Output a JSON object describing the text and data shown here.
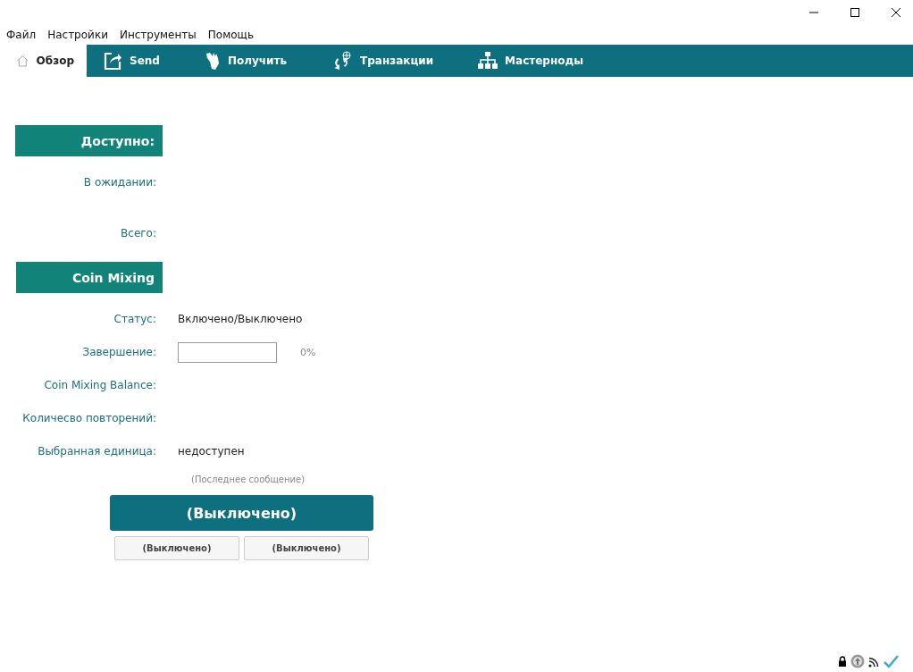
{
  "menu": [
    "Файл",
    "Настройки",
    "Инструменты",
    "Помощь"
  ],
  "tabs": [
    {
      "label": "Обзор",
      "kind": "home",
      "selected": true
    },
    {
      "label": "Send",
      "kind": "send",
      "selected": false
    },
    {
      "label": "Получить",
      "kind": "receive",
      "selected": false
    },
    {
      "label": "Транзакции",
      "kind": "transactions",
      "selected": false
    },
    {
      "label": "Мастерноды",
      "kind": "masternodes",
      "selected": false
    }
  ],
  "balances": {
    "header": "Доступно:",
    "pending": {
      "label": "В ожидании:"
    },
    "total": {
      "label": "Всего:"
    }
  },
  "mixing": {
    "header": "Coin Mixing",
    "status": {
      "label": "Статус:",
      "value": "Включено/Выключено"
    },
    "completion": {
      "label": "Завершение:",
      "level": 0,
      "reading": "0%"
    },
    "balance": {
      "label": "Coin Mixing Balance:"
    },
    "rounds": {
      "label": "Количесво повторений:"
    },
    "denomination": {
      "label": "Выбранная единица:",
      "value": "недоступен"
    },
    "last_message": "(Последнее сообщение)",
    "main_button": "(Выключено)",
    "buttons": [
      "(Выключено)",
      "(Выключено)"
    ]
  }
}
